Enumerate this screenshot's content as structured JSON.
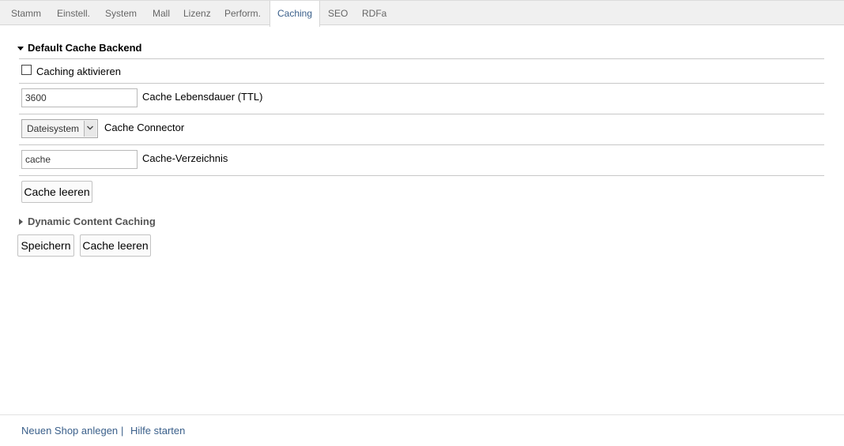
{
  "tabs": [
    {
      "label": "Stamm"
    },
    {
      "label": "Einstell."
    },
    {
      "label": "System"
    },
    {
      "label": "Mall"
    },
    {
      "label": "Lizenz"
    },
    {
      "label": "Perform."
    },
    {
      "label": "Caching",
      "active": true
    },
    {
      "label": "SEO"
    },
    {
      "label": "RDFa"
    }
  ],
  "default_backend": {
    "title": "Default Cache Backend",
    "enable_label": "Caching aktivieren",
    "ttl_value": "3600",
    "ttl_label": "Cache Lebensdauer (TTL)",
    "connector_value": "Dateisystem",
    "connector_label": "Cache Connector",
    "dir_value": "cache",
    "dir_label": "Cache-Verzeichnis",
    "clear_button": "Cache leeren"
  },
  "dynamic_content": {
    "title": "Dynamic Content Caching"
  },
  "actions": {
    "save": "Speichern",
    "clear": "Cache leeren"
  },
  "footer": {
    "new_shop": "Neuen Shop anlegen",
    "separator": "|",
    "help": "Hilfe starten"
  },
  "icons": {
    "expanded": "triangle-down-icon",
    "collapsed": "triangle-right-icon",
    "select": "chevron-down-icon"
  }
}
